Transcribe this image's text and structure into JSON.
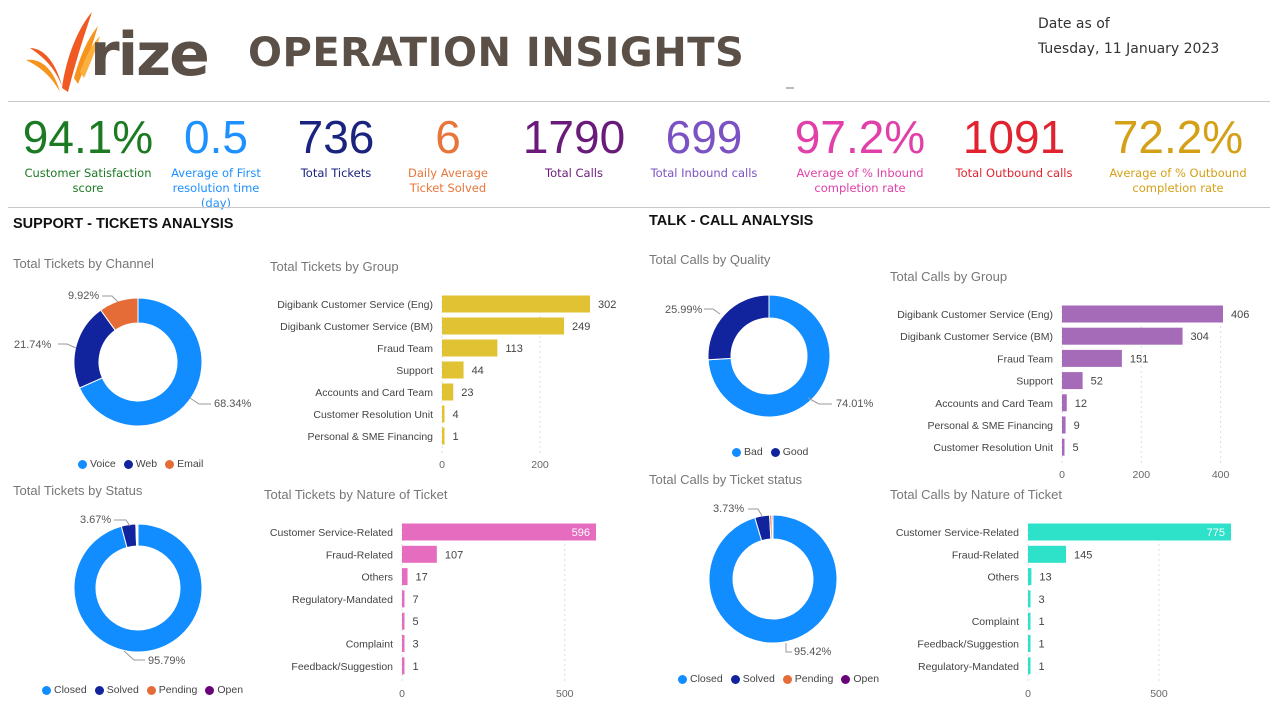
{
  "header": {
    "logo_text": "rize",
    "title": "OPERATION INSIGHTS",
    "date_label": "Date as of",
    "date_value": "Tuesday, 11 January 2023"
  },
  "kpis": [
    {
      "value": "94.1%",
      "label": "Customer Satisfaction score",
      "color": "#1b7a22"
    },
    {
      "value": "0.5",
      "label": "Average of First resolution time (day)",
      "color": "#1e90ff"
    },
    {
      "value": "736",
      "label": "Total Tickets",
      "color": "#1a237e"
    },
    {
      "value": "6",
      "label": "Daily Average Ticket Solved",
      "color": "#e8763a"
    },
    {
      "value": "1790",
      "label": "Total Calls",
      "color": "#6a1b7a"
    },
    {
      "value": "699",
      "label": "Total Inbound calls",
      "color": "#7b52c4"
    },
    {
      "value": "97.2%",
      "label": "Average of % Inbound completion rate",
      "color": "#e040a8"
    },
    {
      "value": "1091",
      "label": "Total Outbound calls",
      "color": "#e0232e"
    },
    {
      "value": "72.2%",
      "label": "Average of % Outbound completion rate",
      "color": "#d4a017"
    }
  ],
  "sections": {
    "support": "SUPPORT - TICKETS ANALYSIS",
    "talk": "TALK - CALL ANALYSIS"
  },
  "chart_data": [
    {
      "id": "tickets_by_channel",
      "type": "pie",
      "title": "Total Tickets by Channel",
      "categories": [
        "Voice",
        "Web",
        "Email"
      ],
      "values": [
        68.34,
        21.74,
        9.92
      ],
      "labels": [
        "68.34%",
        "21.74%",
        "9.92%"
      ],
      "colors": [
        "#118dff",
        "#12239e",
        "#e66c37"
      ],
      "legend": "bottom"
    },
    {
      "id": "tickets_by_group",
      "type": "bar",
      "title": "Total Tickets by Group",
      "categories": [
        "Digibank Customer Service (Eng)",
        "Digibank Customer Service (BM)",
        "Fraud Team",
        "Support",
        "Accounts and Card Team",
        "Customer Resolution Unit",
        "Personal & SME Financing"
      ],
      "values": [
        302,
        249,
        113,
        44,
        23,
        4,
        1
      ],
      "ticks": [
        0,
        200
      ],
      "color": "#e1c233"
    },
    {
      "id": "tickets_by_status",
      "type": "pie",
      "title": "Total Tickets by Status",
      "categories": [
        "Closed",
        "Solved",
        "Pending",
        "Open"
      ],
      "values": [
        95.79,
        3.67,
        0.27,
        0.27
      ],
      "labels": [
        "95.79%",
        "3.67%",
        "",
        ""
      ],
      "colors": [
        "#118dff",
        "#12239e",
        "#e66c37",
        "#6b007b"
      ],
      "legend": "bottom"
    },
    {
      "id": "tickets_by_nature",
      "type": "bar",
      "title": "Total Tickets by Nature of Ticket",
      "categories": [
        "Customer Service-Related",
        "Fraud-Related",
        "Others",
        "Regulatory-Mandated",
        "",
        "Complaint",
        "Feedback/Suggestion"
      ],
      "values": [
        596,
        107,
        17,
        7,
        5,
        3,
        1
      ],
      "ticks": [
        0,
        500
      ],
      "color": "#e66cc0"
    },
    {
      "id": "calls_by_quality",
      "type": "pie",
      "title": "Total Calls by Quality",
      "categories": [
        "Bad",
        "Good"
      ],
      "values": [
        74.01,
        25.99
      ],
      "labels": [
        "74.01%",
        "25.99%"
      ],
      "colors": [
        "#118dff",
        "#12239e"
      ],
      "legend": "bottom"
    },
    {
      "id": "calls_by_group",
      "type": "bar",
      "title": "Total Calls by Group",
      "categories": [
        "Digibank Customer Service (Eng)",
        "Digibank Customer Service (BM)",
        "Fraud Team",
        "Support",
        "Accounts and Card Team",
        "Personal & SME Financing",
        "Customer Resolution Unit"
      ],
      "values": [
        406,
        304,
        151,
        52,
        12,
        9,
        5
      ],
      "ticks": [
        0,
        200,
        400
      ],
      "color": "#a66bb8"
    },
    {
      "id": "calls_by_ticket_status",
      "type": "pie",
      "title": "Total Calls by Ticket status",
      "categories": [
        "Closed",
        "Solved",
        "Pending",
        "Open"
      ],
      "values": [
        95.42,
        3.73,
        0.55,
        0.3
      ],
      "labels": [
        "95.42%",
        "3.73%",
        "",
        ""
      ],
      "colors": [
        "#118dff",
        "#12239e",
        "#e66c37",
        "#6b007b"
      ],
      "legend": "bottom"
    },
    {
      "id": "calls_by_nature",
      "type": "bar",
      "title": "Total Calls by Nature of Ticket",
      "categories": [
        "Customer Service-Related",
        "Fraud-Related",
        "Others",
        "",
        "Complaint",
        "Feedback/Suggestion",
        "Regulatory-Mandated"
      ],
      "values": [
        775,
        145,
        13,
        3,
        1,
        1,
        1
      ],
      "ticks": [
        0,
        500
      ],
      "color": "#2de2c8"
    }
  ]
}
